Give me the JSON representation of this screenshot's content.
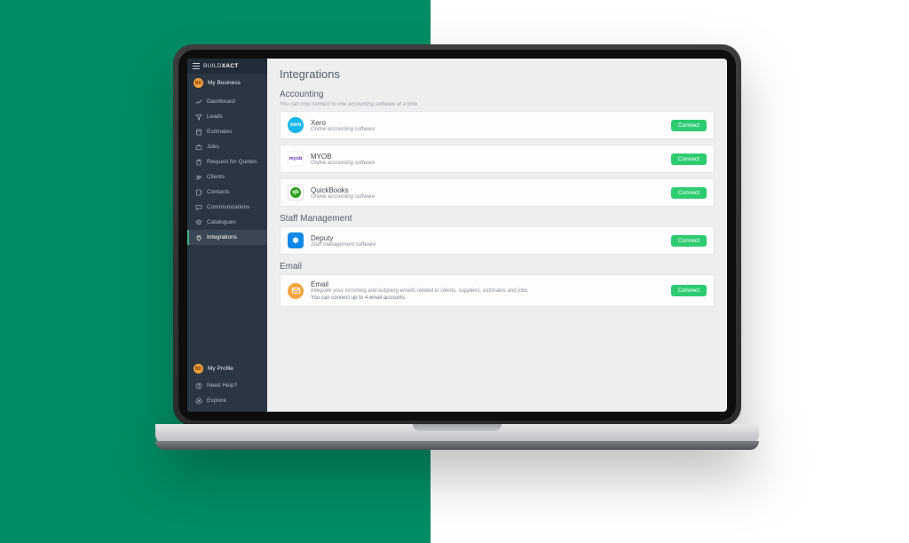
{
  "brand": {
    "prefix": "BUILD",
    "suffix": "XACT"
  },
  "sidebar": {
    "my_business": "My Business",
    "items": [
      {
        "label": "Dashboard",
        "icon": "chart-line-icon"
      },
      {
        "label": "Leads",
        "icon": "funnel-icon"
      },
      {
        "label": "Estimates",
        "icon": "calculator-icon"
      },
      {
        "label": "Jobs",
        "icon": "briefcase-icon"
      },
      {
        "label": "Request for Quotes",
        "icon": "clipboard-icon"
      },
      {
        "label": "Clients",
        "icon": "users-icon"
      },
      {
        "label": "Contacts",
        "icon": "address-book-icon"
      },
      {
        "label": "Communications",
        "icon": "chat-icon"
      },
      {
        "label": "Catalogues",
        "icon": "stack-icon"
      },
      {
        "label": "Integrations",
        "icon": "plug-icon",
        "active": true
      }
    ],
    "my_profile": "My Profile",
    "footer": [
      {
        "label": "Need Help?",
        "icon": "help-icon"
      },
      {
        "label": "Explore",
        "icon": "compass-icon"
      }
    ],
    "avatar_initials": "BD"
  },
  "main": {
    "title": "Integrations",
    "sections": [
      {
        "title": "Accounting",
        "hint": "You can only connect to one accounting software at a time.",
        "items": [
          {
            "name": "Xero",
            "sub": "Online accounting software",
            "badge": "xero",
            "badge_text": "xero",
            "button": "Connect"
          },
          {
            "name": "MYOB",
            "sub": "Online accounting software",
            "badge": "myob",
            "badge_text": "myob",
            "button": "Connect"
          },
          {
            "name": "QuickBooks",
            "sub": "Online accounting software",
            "badge": "qb",
            "badge_text": "qb",
            "button": "Connect"
          }
        ]
      },
      {
        "title": "Staff Management",
        "items": [
          {
            "name": "Deputy",
            "sub": "Staff management software",
            "badge": "deputy",
            "badge_text": "✱",
            "button": "Connect"
          }
        ]
      },
      {
        "title": "Email",
        "items": [
          {
            "name": "Email",
            "sub": "Integrate your incoming and outgoing emails related to clients, suppliers, estimates and jobs.",
            "note": "You can connect up to 4 email accounts.",
            "badge": "email",
            "badge_text": "✉",
            "button": "Connect"
          }
        ]
      }
    ]
  }
}
